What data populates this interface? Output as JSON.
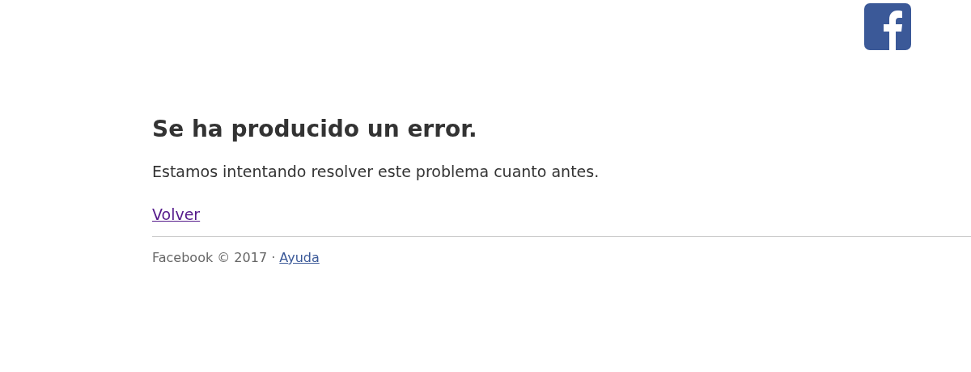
{
  "error": {
    "title": "Se ha producido un error.",
    "message": "Estamos intentando resolver este problema cuanto antes.",
    "back_link": "Volver"
  },
  "footer": {
    "copyright": "Facebook © 2017 · ",
    "help_link": "Ayuda"
  }
}
